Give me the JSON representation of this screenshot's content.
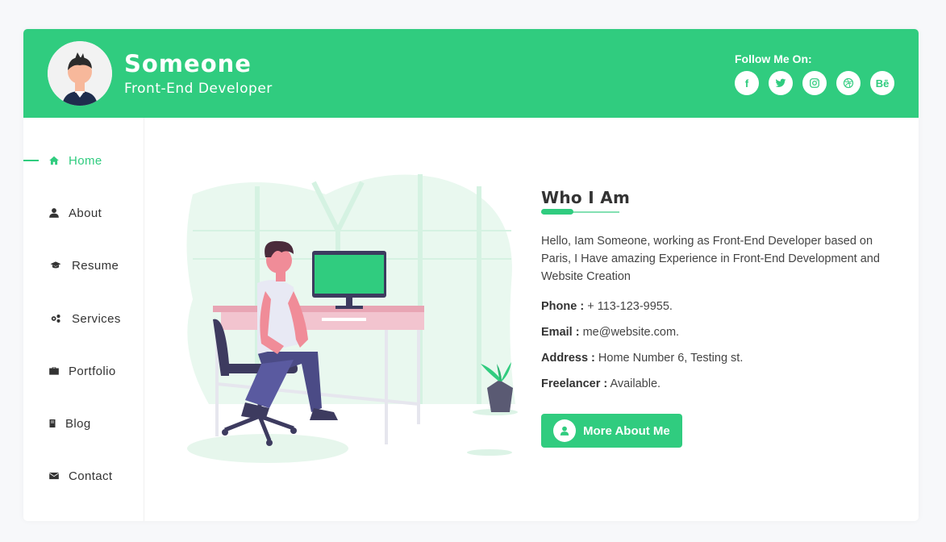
{
  "profile": {
    "name": "Someone",
    "role": "Front-End Developer"
  },
  "social": {
    "label": "Follow Me On:",
    "links": [
      {
        "icon": "facebook-icon",
        "text": "f"
      },
      {
        "icon": "twitter-icon",
        "text": ""
      },
      {
        "icon": "instagram-icon",
        "text": ""
      },
      {
        "icon": "dribbble-icon",
        "text": ""
      },
      {
        "icon": "behance-icon",
        "text": "Bē"
      }
    ]
  },
  "nav": {
    "items": [
      {
        "label": "Home",
        "icon": "home-icon",
        "active": true
      },
      {
        "label": "About",
        "icon": "user-icon",
        "active": false
      },
      {
        "label": "Resume",
        "icon": "graduation-cap-icon",
        "active": false
      },
      {
        "label": "Services",
        "icon": "cogs-icon",
        "active": false
      },
      {
        "label": "Portfolio",
        "icon": "briefcase-icon",
        "active": false
      },
      {
        "label": "Blog",
        "icon": "book-icon",
        "active": false
      },
      {
        "label": "Contact",
        "icon": "envelope-icon",
        "active": false
      }
    ]
  },
  "about": {
    "title": "Who I Am",
    "intro": "Hello, Iam Someone, working as Front-End Developer based on Paris, I Have amazing Experience in Front-End Development and Website Creation",
    "phone_label": "Phone :",
    "phone": "+ 113-123-9955.",
    "email_label": "Email :",
    "email": "me@website.com.",
    "address_label": "Address :",
    "address": "Home Number 6, Testing st.",
    "freelancer_label": "Freelancer :",
    "freelancer": "Available.",
    "button_label": "More About Me"
  },
  "colors": {
    "accent": "#30cc7f",
    "background": "#f7f8fa",
    "text": "#333333"
  }
}
